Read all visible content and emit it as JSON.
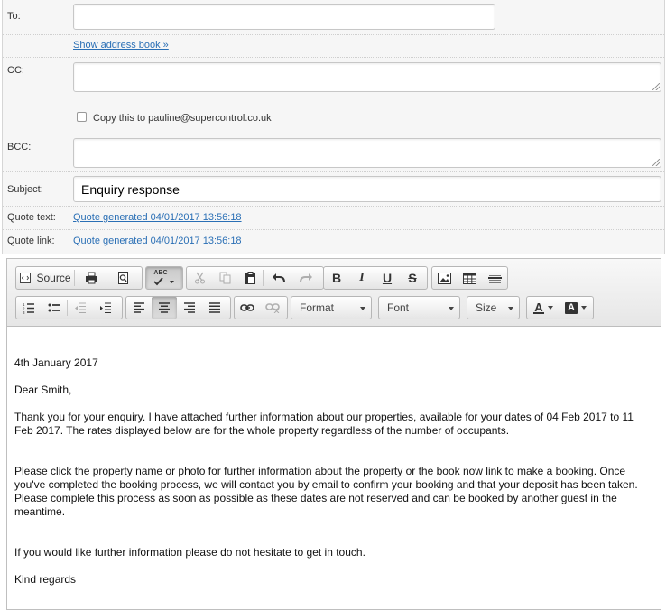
{
  "form": {
    "to_label": "To:",
    "to_value": "",
    "show_address_book": "Show address book »",
    "cc_label": "CC:",
    "cc_value": "",
    "copy_label": "Copy this to pauline@supercontrol.co.uk",
    "copy_checked": false,
    "bcc_label": "BCC:",
    "bcc_value": "",
    "subject_label": "Subject:",
    "subject_value": "Enquiry response",
    "quote_text_label": "Quote text:",
    "quote_text_link": "Quote generated 04/01/2017 13:56:18",
    "quote_link_label": "Quote link:",
    "quote_link_link": "Quote generated 04/01/2017 13:56:18"
  },
  "toolbar": {
    "source_label": "Source",
    "format_label": "Format",
    "font_label": "Font",
    "size_label": "Size",
    "spellcheck_text": "ABC",
    "bold": "B",
    "italic": "I",
    "underline": "U",
    "strike": "S",
    "text_color_glyph": "A",
    "bg_color_glyph": "A",
    "active_align": "center"
  },
  "body": {
    "date_line": "4th January 2017",
    "greeting": "Dear Smith,",
    "para1": "Thank you for your enquiry. I have attached further information about our properties, available for your dates of 04 Feb 2017 to 11 Feb 2017. The rates displayed below are for the whole property regardless of the number of occupants.",
    "para2": "Please click the property name or photo for further information about the property or the book now link to make a booking. Once you've completed the booking process, we will contact you by email to confirm your booking and that your deposit has been taken. Please complete this process as soon as possible as these dates are not reserved and can be booked by another guest in the meantime.",
    "para3": "If you would like further information please do not hesitate to get in touch.",
    "signoff": "Kind regards"
  }
}
